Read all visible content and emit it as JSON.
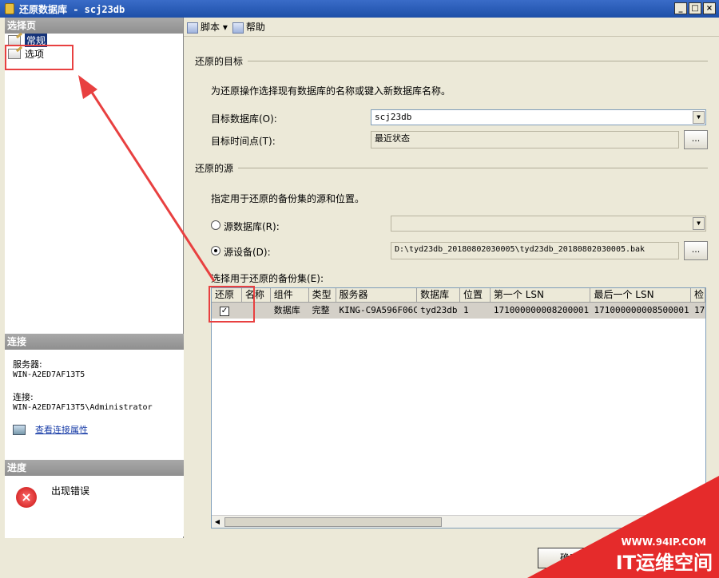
{
  "window": {
    "title": "还原数据库 - scj23db"
  },
  "left": {
    "select_page_header": "选择页",
    "nav_items": [
      {
        "label": "常规",
        "selected": true
      },
      {
        "label": "选项",
        "selected": false
      }
    ],
    "connection_header": "连接",
    "server_label": "服务器:",
    "server_value": "WIN-A2ED7AF13T5",
    "connection_label": "连接:",
    "connection_value": "WIN-A2ED7AF13T5\\Administrator",
    "view_props_link": "查看连接属性",
    "progress_header": "进度",
    "progress_status": "出现错误"
  },
  "toolbar": {
    "script_label": "脚本",
    "help_label": "帮助"
  },
  "target": {
    "group_title": "还原的目标",
    "instruction": "为还原操作选择现有数据库的名称或键入新数据库名称。",
    "db_label": "目标数据库(O):",
    "db_value": "scj23db",
    "time_label": "目标时间点(T):",
    "time_value": "最近状态",
    "browse_label": "..."
  },
  "source": {
    "group_title": "还原的源",
    "instruction": "指定用于还原的备份集的源和位置。",
    "src_db_label": "源数据库(R):",
    "src_db_value": "",
    "src_device_label": "源设备(D):",
    "src_device_value": "D:\\tyd23db_20180802030005\\tyd23db_20180802030005.bak",
    "browse_label": "...",
    "selected_source": "device"
  },
  "backupsets": {
    "label": "选择用于还原的备份集(E):",
    "columns": [
      "还原",
      "名称",
      "组件",
      "类型",
      "服务器",
      "数据库",
      "位置",
      "第一个 LSN",
      "最后一个 LSN",
      "检"
    ],
    "rows": [
      {
        "restore": true,
        "name": "",
        "component": "数据库",
        "type": "完整",
        "server": "KING-C9A596F06C",
        "database": "tyd23db",
        "position": "1",
        "first_lsn": "171000000008200001",
        "last_lsn": "171000000008500001",
        "check": "17"
      }
    ]
  },
  "footer": {
    "ok_label": "确定"
  },
  "watermark": {
    "url": "WWW.94IP.COM",
    "title": "IT运维空间"
  },
  "colors": {
    "annotation": "#e84040",
    "selection": "#16347a",
    "link": "#1a3ea8"
  }
}
